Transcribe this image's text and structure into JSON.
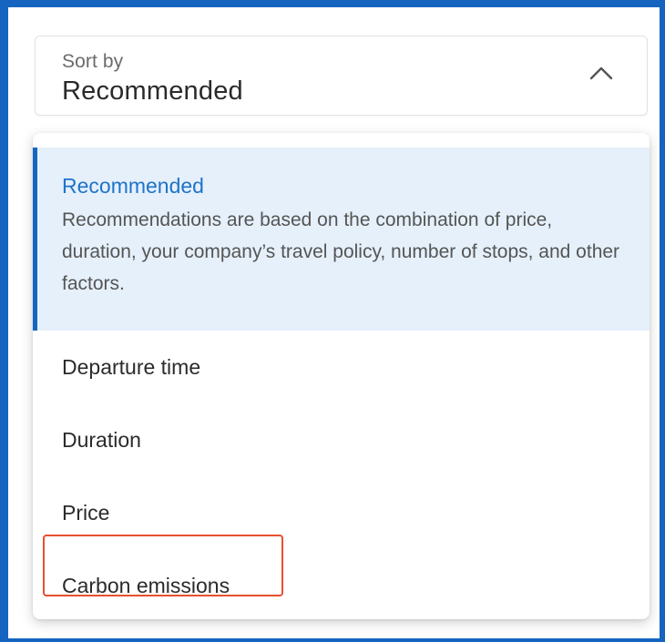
{
  "sort": {
    "label": "Sort by",
    "value": "Recommended",
    "expanded": true,
    "chevron_icon": "chevron-up-icon"
  },
  "options": [
    {
      "label": "Recommended",
      "description": "Recommendations are based on the combination of price, duration, your company’s travel policy, number of stops, and other factors.",
      "selected": true
    },
    {
      "label": "Departure time"
    },
    {
      "label": "Duration"
    },
    {
      "label": "Price"
    },
    {
      "label": "Carbon emissions",
      "highlighted": true
    }
  ],
  "colors": {
    "accent": "#1565c0",
    "selected_bg": "#e5f0fb",
    "selected_text": "#1f73c9",
    "highlight": "#e8502f"
  }
}
